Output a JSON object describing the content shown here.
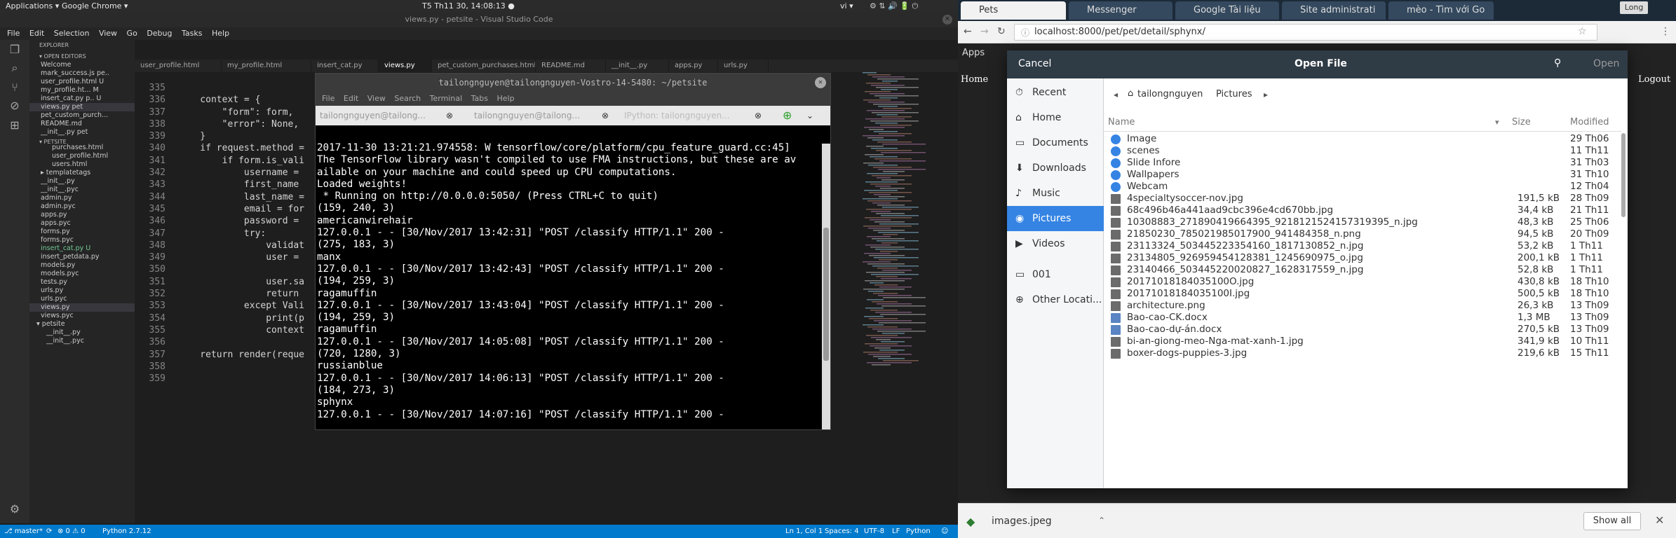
{
  "sysbar": {
    "applications": "Applications ▾",
    "chrome": "Google Chrome ▾",
    "clock": "T5 Th11 30, 14:08:13 ●",
    "lang": "vi ▾"
  },
  "vscode": {
    "title": "views.py - petsite - Visual Studio Code",
    "menu": [
      "File",
      "Edit",
      "Selection",
      "View",
      "Go",
      "Debug",
      "Tasks",
      "Help"
    ],
    "explorer_title": "EXPLORER",
    "open_editors_title": "▾ OPEN EDITORS",
    "open_editors": [
      "Welcome",
      "mark_success.js pe..",
      "user_profile.html U",
      "my_profile.ht... M",
      "insert_cat.py p.. U",
      "views.py pet",
      "pet_custom_purch...",
      "README.md",
      "__init__.py pet"
    ],
    "petsite_title": "▾ PETSITE",
    "tree": [
      "purchases.html",
      "user_profile.html",
      "users.html",
      "▸ templatetags",
      "__init__.py",
      "__init__.pyc",
      "admin.py",
      "admin.pyc",
      "apps.py",
      "apps.pyc",
      "forms.py",
      "forms.pyc",
      "insert_cat.py U",
      "insert_petdata.py",
      "models.py",
      "models.pyc",
      "tests.py",
      "urls.py",
      "urls.pyc",
      "views.py",
      "views.pyc",
      "▾ petsite",
      "__init__.py",
      "__init__.pyc"
    ],
    "tabs": [
      "user_profile.html",
      "my_profile.html",
      "insert_cat.py",
      "views.py",
      "pet_custom_purchases.html",
      "README.md",
      "__init__.py",
      "apps.py",
      "urls.py"
    ],
    "line_numbers": [
      "335",
      "336",
      "337",
      "338",
      "339",
      "340",
      "341",
      "342",
      "343",
      "344",
      "345",
      "346",
      "347",
      "348",
      "349",
      "350",
      "351",
      "352",
      "353",
      "354",
      "355",
      "356",
      "357",
      "358",
      "359"
    ],
    "code_lines": [
      "",
      "    context = {",
      "        \"form\": form,",
      "        \"error\": None,",
      "    }",
      "    if request.method =",
      "        if form.is_vali",
      "            username =",
      "            first_name",
      "            last_name =",
      "            email = for",
      "            password =",
      "            try:",
      "                validat",
      "                user =",
      "",
      "                user.sa",
      "                return",
      "            except Vali",
      "                print(p",
      "                context",
      "",
      "    return render(reque",
      "",
      ""
    ],
    "status": {
      "branch": "⎇ master*",
      "sync": "⟳",
      "problems": "⊗ 0 ⚠ 0",
      "python": "Python 2.7.12",
      "pos": "Ln 1, Col 1",
      "spaces": "Spaces: 4",
      "enc": "UTF-8",
      "eol": "LF",
      "lang": "Python"
    }
  },
  "terminal": {
    "title": "tailongnguyen@tailongnguyen-Vostro-14-5480: ~/petsite",
    "menu": [
      "File",
      "Edit",
      "View",
      "Search",
      "Terminal",
      "Tabs",
      "Help"
    ],
    "tabs": [
      "tailongnguyen@tailong...",
      "tailongnguyen@tailong...",
      "IPython: tailongnguyen..."
    ],
    "lines": [
      "2017-11-30 13:21:21.974558: W tensorflow/core/platform/cpu_feature_guard.cc:45]",
      "The TensorFlow library wasn't compiled to use FMA instructions, but these are av",
      "ailable on your machine and could speed up CPU computations.",
      "Loaded weights!",
      " * Running on http://0.0.0.0:5050/ (Press CTRL+C to quit)",
      "(159, 240, 3)",
      "americanwirehair",
      "127.0.0.1 - - [30/Nov/2017 13:42:31] \"POST /classify HTTP/1.1\" 200 -",
      "(275, 183, 3)",
      "manx",
      "127.0.0.1 - - [30/Nov/2017 13:42:43] \"POST /classify HTTP/1.1\" 200 -",
      "(194, 259, 3)",
      "ragamuffin",
      "127.0.0.1 - - [30/Nov/2017 13:43:04] \"POST /classify HTTP/1.1\" 200 -",
      "(194, 259, 3)",
      "ragamuffin",
      "127.0.0.1 - - [30/Nov/2017 14:05:08] \"POST /classify HTTP/1.1\" 200 -",
      "(720, 1280, 3)",
      "russianblue",
      "127.0.0.1 - - [30/Nov/2017 14:06:13] \"POST /classify HTTP/1.1\" 200 -",
      "(184, 273, 3)",
      "sphynx",
      "127.0.0.1 - - [30/Nov/2017 14:07:16] \"POST /classify HTTP/1.1\" 200 -",
      "_"
    ]
  },
  "chrome": {
    "tabs": [
      "Pets",
      "Messenger",
      "Google Tài liệu",
      "Site administrati",
      "mèo - Tìm với Go"
    ],
    "profile": "Long",
    "url": "localhost:8000/pet/pet/detail/sphynx/",
    "apps": "Apps",
    "page_home": "Home",
    "page_logout": "Logout",
    "download_file": "images.jpeg",
    "show_all": "Show all"
  },
  "dialog": {
    "cancel": "Cancel",
    "title": "Open File",
    "open": "Open",
    "sidebar": [
      "Recent",
      "Home",
      "Documents",
      "Downloads",
      "Music",
      "Pictures",
      "Videos",
      "001",
      "Other Locati..."
    ],
    "path": [
      "tailongnguyen",
      "Pictures"
    ],
    "headers": {
      "name": "Name",
      "size": "Size",
      "modified": "Modified"
    },
    "files": [
      {
        "name": "Image",
        "size": "",
        "mod": "29 Th06",
        "type": "folder"
      },
      {
        "name": "scenes",
        "size": "",
        "mod": "11 Th11",
        "type": "folder"
      },
      {
        "name": "Slide Infore",
        "size": "",
        "mod": "31 Th03",
        "type": "folder"
      },
      {
        "name": "Wallpapers",
        "size": "",
        "mod": "31 Th10",
        "type": "folder"
      },
      {
        "name": "Webcam",
        "size": "",
        "mod": "12 Th04",
        "type": "folder"
      },
      {
        "name": "4specialtysoccer-nov.jpg",
        "size": "191,5 kB",
        "mod": "28 Th09",
        "type": "image"
      },
      {
        "name": "68c496b46a441aad9cbc396e4cd670bb.jpg",
        "size": "34,4 kB",
        "mod": "21 Th11",
        "type": "image"
      },
      {
        "name": "10308883_271890419664395_9218121524157319395_n.jpg",
        "size": "48,3 kB",
        "mod": "25 Th06",
        "type": "image"
      },
      {
        "name": "21850230_785021985017900_941484358_n.png",
        "size": "94,5 kB",
        "mod": "20 Th09",
        "type": "image"
      },
      {
        "name": "23113324_503445223354160_1817130852_n.jpg",
        "size": "53,2 kB",
        "mod": "1 Th11",
        "type": "image"
      },
      {
        "name": "23134805_926959454128381_1245690975_o.jpg",
        "size": "200,1 kB",
        "mod": "1 Th11",
        "type": "image"
      },
      {
        "name": "23140466_503445220020827_1628317559_n.jpg",
        "size": "52,8 kB",
        "mod": "1 Th11",
        "type": "image"
      },
      {
        "name": "20171018184035100O.jpg",
        "size": "430,8 kB",
        "mod": "18 Th10",
        "type": "image"
      },
      {
        "name": "20171018184035100I.jpg",
        "size": "500,5 kB",
        "mod": "18 Th10",
        "type": "image"
      },
      {
        "name": "architecture.png",
        "size": "26,3 kB",
        "mod": "13 Th09",
        "type": "image"
      },
      {
        "name": "Bao-cao-CK.docx",
        "size": "1,3 MB",
        "mod": "13 Th09",
        "type": "doc"
      },
      {
        "name": "Bao-cao-dự-án.docx",
        "size": "270,5 kB",
        "mod": "13 Th09",
        "type": "doc"
      },
      {
        "name": "bi-an-giong-meo-Nga-mat-xanh-1.jpg",
        "size": "341,9 kB",
        "mod": "10 Th11",
        "type": "image"
      },
      {
        "name": "boxer-dogs-puppies-3.jpg",
        "size": "219,6 kB",
        "mod": "15 Th11",
        "type": "image"
      }
    ]
  }
}
